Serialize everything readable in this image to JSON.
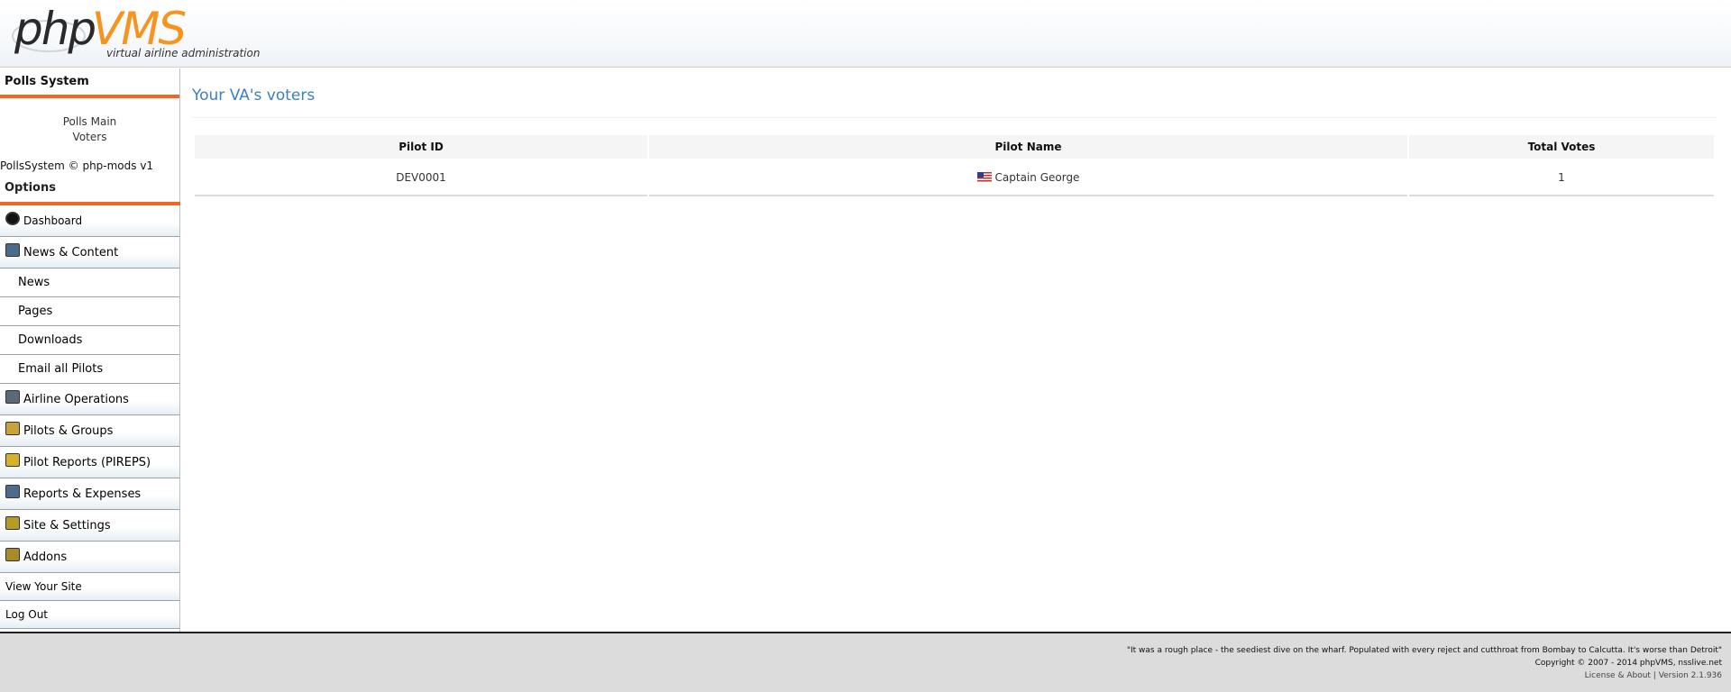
{
  "header": {
    "logo_php": "php",
    "logo_vms": "VMS",
    "logo_tagline": "virtual airline administration",
    "logo_colors": {
      "php": "#2a2a2a",
      "vms": "#f7941d"
    }
  },
  "sidebar": {
    "polls_title": "Polls System",
    "polls_links": [
      {
        "label": "Polls Main"
      },
      {
        "label": "Voters"
      }
    ],
    "polls_copyright": "PollsSystem © php-mods v1",
    "options_title": "Options",
    "menu": [
      {
        "label": "Dashboard",
        "icon": "dashboard-icon",
        "kind": "section"
      },
      {
        "label": "News & Content",
        "icon": "news-icon",
        "kind": "section"
      },
      {
        "label": "News",
        "kind": "sub"
      },
      {
        "label": "Pages",
        "kind": "sub"
      },
      {
        "label": "Downloads",
        "kind": "sub"
      },
      {
        "label": "Email all Pilots",
        "kind": "sub"
      },
      {
        "label": "Airline Operations",
        "icon": "airline-icon",
        "kind": "section"
      },
      {
        "label": "Pilots & Groups",
        "icon": "pilots-icon",
        "kind": "section"
      },
      {
        "label": "Pilot Reports (PIREPS)",
        "icon": "pireps-icon",
        "kind": "section"
      },
      {
        "label": "Reports & Expenses",
        "icon": "reports-icon",
        "kind": "section"
      },
      {
        "label": "Site & Settings",
        "icon": "settings-icon",
        "kind": "section"
      },
      {
        "label": "Addons",
        "icon": "addons-icon",
        "kind": "section"
      },
      {
        "label": "View Your Site",
        "kind": "plain"
      },
      {
        "label": "Log Out",
        "kind": "plain"
      }
    ],
    "accent_color": "#f26522"
  },
  "main": {
    "title": "Your VA's voters",
    "table": {
      "headers": [
        "Pilot ID",
        "Pilot Name",
        "Total Votes"
      ],
      "rows": [
        {
          "pilot_id": "DEV0001",
          "pilot_name": "Captain George",
          "flag_icon": "us-flag-icon",
          "total_votes": "1"
        }
      ]
    },
    "title_color": "#3a7fc5"
  },
  "footer": {
    "quote": "\"It was a rough place - the seediest dive on the wharf. Populated with every reject and cutthroat from Bombay to Calcutta. It's worse than Detroit\"",
    "copyright": "Copyright © 2007 - 2014 phpVMS, nsslive.net",
    "links": "License & About | Version 2.1.936"
  }
}
